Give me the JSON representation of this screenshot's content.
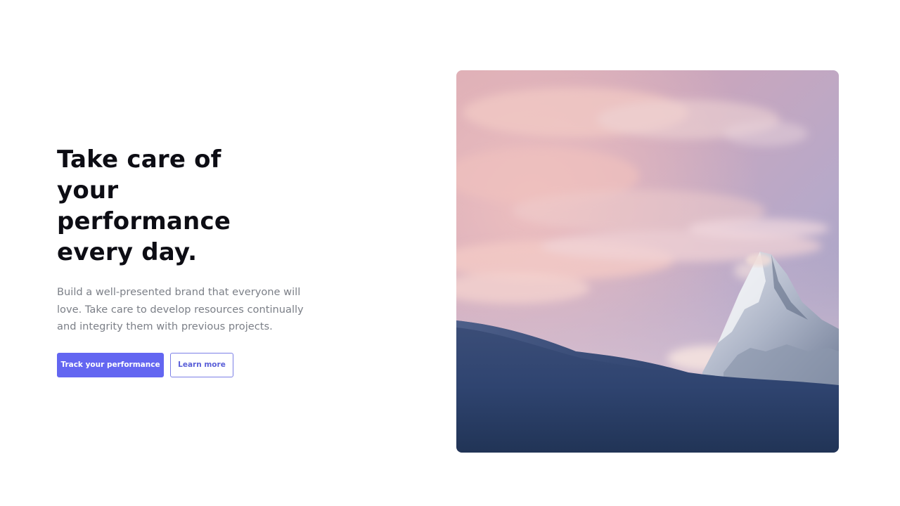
{
  "hero": {
    "headline": "Take care of your performance every day.",
    "description": "Build a well-presented brand that everyone will love. Take care to develop resources continually and integrity them with previous projects.",
    "primary_button_label": "Track your performance",
    "secondary_button_label": "Learn more"
  },
  "colors": {
    "accent": "#6366f1",
    "headline": "#0d0d14",
    "body_text": "#7b7f87"
  }
}
